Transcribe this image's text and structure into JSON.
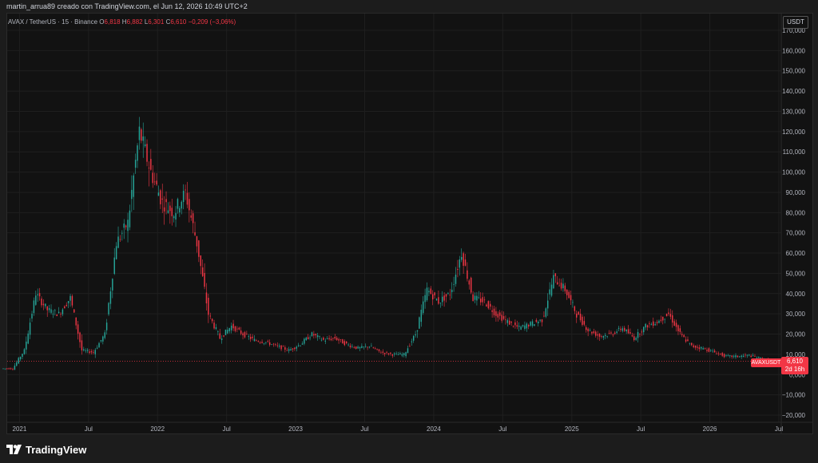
{
  "header": {
    "title": "martin_arrua89 creado con TradingView.com, el Jun 12, 2026 10:49 UTC+2"
  },
  "legend": {
    "symbol": "AVAX / TetherUS · 15 · Binance",
    "open_label": "O",
    "open": "6,818",
    "high_label": "H",
    "high": "6,882",
    "low_label": "L",
    "low": "6,301",
    "close_label": "C",
    "close": "6,610",
    "change": "−0,209 (−3,06%)"
  },
  "currency_button": "USDT",
  "price_badge": {
    "symbol": "AVAXUSDT",
    "price": "6,610",
    "countdown": "2d 16h"
  },
  "footer": {
    "brand": "TradingView"
  },
  "colors": {
    "up": "#26a69a",
    "down": "#f23645",
    "background": "#121212"
  },
  "chart_data": {
    "type": "candlestick",
    "title": "",
    "xlabel": "",
    "ylabel": "",
    "x_ticks": [
      "2021",
      "Jul",
      "2022",
      "Jul",
      "2023",
      "Jul",
      "2024",
      "Jul",
      "2025",
      "Jul",
      "2026",
      "Jul"
    ],
    "x_tick_dates": [
      "2021-01",
      "2021-07",
      "2022-01",
      "2022-07",
      "2023-01",
      "2023-07",
      "2024-01",
      "2024-07",
      "2025-01",
      "2025-07",
      "2026-01",
      "2026-07"
    ],
    "y_ticks": [
      "170,000",
      "160,000",
      "150,000",
      "140,000",
      "130,000",
      "120,000",
      "110,000",
      "100,000",
      "90,000",
      "80,000",
      "70,000",
      "60,000",
      "50,000",
      "40,000",
      "30,000",
      "20,000",
      "10,000",
      "0,000",
      "−10,000",
      "−20,000"
    ],
    "ylim": [
      -20,
      170
    ],
    "xlim": [
      "2020-12",
      "2026-07"
    ],
    "last_price": 6.61,
    "grid": true,
    "series": [
      {
        "x": [
          "2020-12",
          "2021-01",
          "2021-02",
          "2021-03",
          "2021-04",
          "2021-05",
          "2021-06",
          "2021-07",
          "2021-08",
          "2021-09",
          "2021-10",
          "2021-11",
          "2021-12",
          "2022-01",
          "2022-02",
          "2022-03",
          "2022-04",
          "2022-05",
          "2022-06",
          "2022-07",
          "2022-08",
          "2022-09",
          "2022-10",
          "2022-11",
          "2022-12",
          "2023-01",
          "2023-02",
          "2023-03",
          "2023-04",
          "2023-05",
          "2023-06",
          "2023-07",
          "2023-08",
          "2023-09",
          "2023-10",
          "2023-11",
          "2023-12",
          "2024-01",
          "2024-02",
          "2024-03",
          "2024-04",
          "2024-05",
          "2024-06",
          "2024-07",
          "2024-08",
          "2024-09",
          "2024-10",
          "2024-11",
          "2024-12",
          "2025-01",
          "2025-02",
          "2025-03",
          "2025-04",
          "2025-05",
          "2025-06",
          "2025-07",
          "2025-08",
          "2025-09",
          "2025-10",
          "2025-11",
          "2025-12",
          "2026-01",
          "2026-02",
          "2026-03",
          "2026-04",
          "2026-05",
          "2026-06"
        ],
        "y": [
          3,
          12,
          40,
          32,
          30,
          38,
          12,
          11,
          20,
          65,
          75,
          120,
          100,
          85,
          80,
          90,
          65,
          30,
          18,
          24,
          20,
          17,
          16,
          14,
          12,
          15,
          20,
          17,
          18,
          15,
          13,
          14,
          11,
          10,
          10,
          20,
          42,
          36,
          40,
          60,
          38,
          36,
          30,
          26,
          23,
          25,
          27,
          48,
          42,
          30,
          22,
          19,
          20,
          23,
          18,
          24,
          26,
          30,
          20,
          14,
          13,
          11,
          9,
          9,
          9.5,
          8,
          6.61
        ]
      }
    ]
  }
}
